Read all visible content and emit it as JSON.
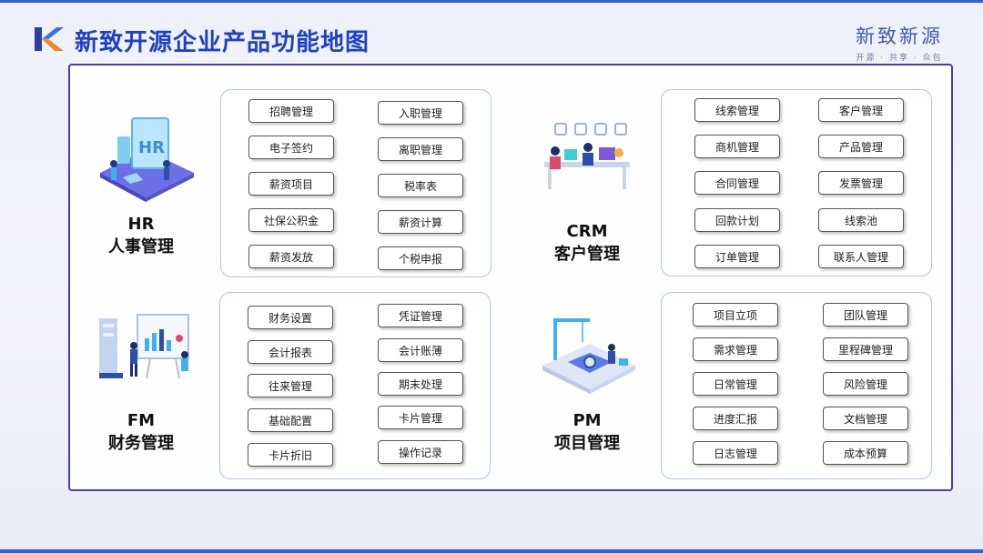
{
  "header": {
    "title": "新致开源企业产品功能地图",
    "brand_name": "新致新源",
    "brand_slogan": "开源 · 共享 · 众包"
  },
  "colors": {
    "accent": "#1f3fc8",
    "frame_border": "#4b3bb0",
    "group_border": "#a9c8ef",
    "chip_border": "#555555"
  },
  "modules": {
    "hr": {
      "code": "HR",
      "name": "人事管理",
      "icon": "hr-illustration-icon",
      "left": [
        "招聘管理",
        "电子签约",
        "薪资项目",
        "社保公积金",
        "薪资发放"
      ],
      "right": [
        "入职管理",
        "离职管理",
        "税率表",
        "薪资计算",
        "个税申报"
      ]
    },
    "crm": {
      "code": "CRM",
      "name": "客户管理",
      "icon": "crm-illustration-icon",
      "left": [
        "线索管理",
        "商机管理",
        "合同管理",
        "回款计划",
        "订单管理"
      ],
      "right": [
        "客户管理",
        "产品管理",
        "发票管理",
        "线索池",
        "联系人管理"
      ]
    },
    "fm": {
      "code": "FM",
      "name": "财务管理",
      "icon": "fm-illustration-icon",
      "left": [
        "财务设置",
        "会计报表",
        "往来管理",
        "基础配置",
        "卡片折旧"
      ],
      "right": [
        "凭证管理",
        "会计账薄",
        "期末处理",
        "卡片管理",
        "操作记录"
      ]
    },
    "pm": {
      "code": "PM",
      "name": "项目管理",
      "icon": "pm-illustration-icon",
      "left": [
        "项目立项",
        "需求管理",
        "日常管理",
        "进度汇报",
        "日志管理"
      ],
      "right": [
        "团队管理",
        "里程碑管理",
        "风险管理",
        "文档管理",
        "成本预算"
      ]
    }
  }
}
